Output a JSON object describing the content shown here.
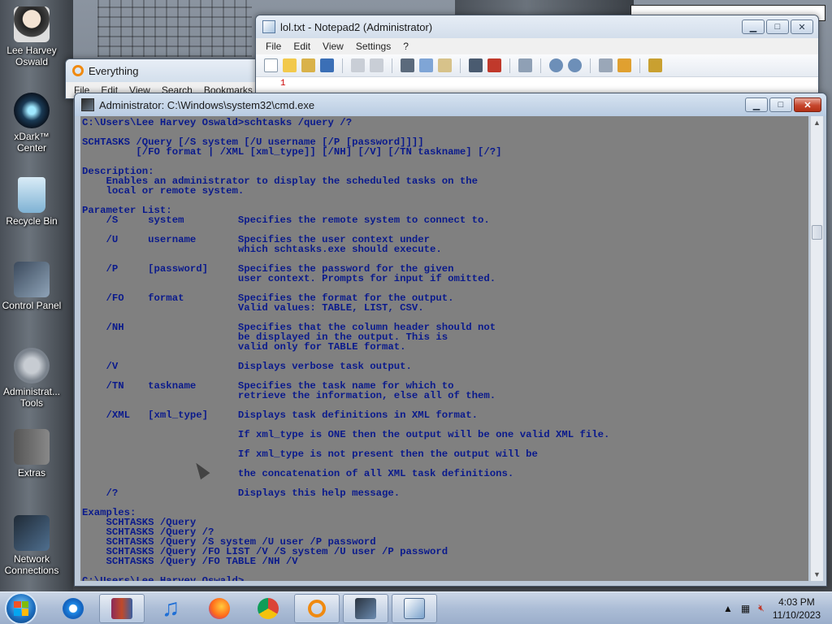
{
  "desktop": {
    "icons": [
      {
        "label": "Lee Harvey Oswald"
      },
      {
        "label": "xDark™ Center"
      },
      {
        "label": "Recycle Bin"
      },
      {
        "label": "Control Panel"
      },
      {
        "label": "Administrat... Tools"
      },
      {
        "label": "Extras"
      },
      {
        "label": "Network Connections"
      }
    ]
  },
  "notepad": {
    "title": "lol.txt - Notepad2 (Administrator)",
    "menu": [
      "File",
      "Edit",
      "View",
      "Settings",
      "?"
    ],
    "line_number": "1"
  },
  "everything": {
    "title": "Everything",
    "menu": [
      "File",
      "Edit",
      "View",
      "Search",
      "Bookmarks"
    ]
  },
  "cmd": {
    "title": "Administrator: C:\\Windows\\system32\\cmd.exe",
    "output": "C:\\Users\\Lee Harvey Oswald>schtasks /query /?\n\nSCHTASKS /Query [/S system [/U username [/P [password]]]]\n         [/FO format | /XML [xml_type]] [/NH] [/V] [/TN taskname] [/?]\n\nDescription:\n    Enables an administrator to display the scheduled tasks on the\n    local or remote system.\n\nParameter List:\n    /S     system         Specifies the remote system to connect to.\n\n    /U     username       Specifies the user context under\n                          which schtasks.exe should execute.\n\n    /P     [password]     Specifies the password for the given\n                          user context. Prompts for input if omitted.\n\n    /FO    format         Specifies the format for the output.\n                          Valid values: TABLE, LIST, CSV.\n\n    /NH                   Specifies that the column header should not\n                          be displayed in the output. This is\n                          valid only for TABLE format.\n\n    /V                    Displays verbose task output.\n\n    /TN    taskname       Specifies the task name for which to\n                          retrieve the information, else all of them.\n\n    /XML   [xml_type]     Displays task definitions in XML format.\n\n                          If xml_type is ONE then the output will be one valid XML file.\n\n                          If xml_type is not present then the output will be\n\n                          the concatenation of all XML task definitions.\n\n    /?                    Displays this help message.\n\nExamples:\n    SCHTASKS /Query\n    SCHTASKS /Query /?\n    SCHTASKS /Query /S system /U user /P password\n    SCHTASKS /Query /FO LIST /V /S system /U user /P password\n    SCHTASKS /Query /FO TABLE /NH /V\n\nC:\\Users\\Lee Harvey Oswald>_"
  },
  "taskbar": {
    "apps": [
      "internet-explorer",
      "winrar",
      "music-player",
      "firefox",
      "chrome",
      "everything-search",
      "cmd",
      "notepad2"
    ],
    "time": "4:03 PM",
    "date": "11/10/2023"
  }
}
